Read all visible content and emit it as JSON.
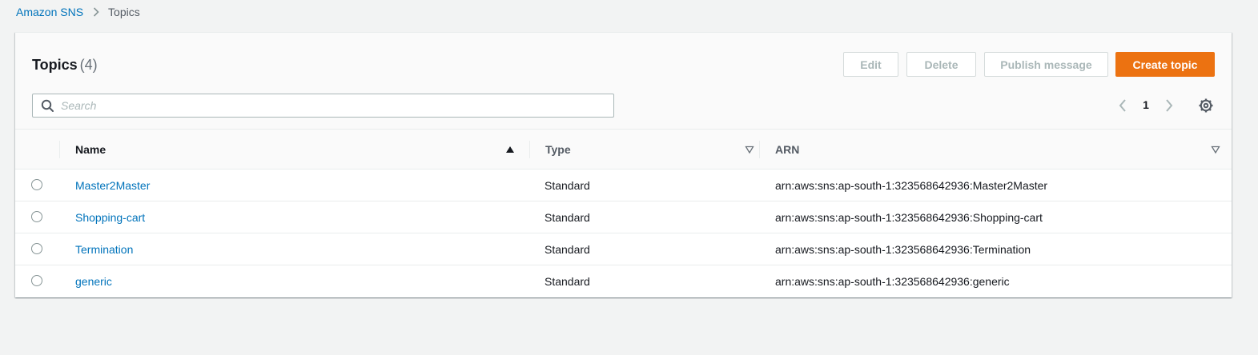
{
  "breadcrumb": {
    "service": "Amazon SNS",
    "current": "Topics"
  },
  "panel": {
    "title": "Topics",
    "count": "(4)"
  },
  "actions": {
    "edit": "Edit",
    "delete": "Delete",
    "publish": "Publish message",
    "create": "Create topic"
  },
  "search": {
    "placeholder": "Search",
    "value": ""
  },
  "pagination": {
    "page": "1"
  },
  "table": {
    "columns": {
      "name": "Name",
      "type": "Type",
      "arn": "ARN"
    },
    "rows": [
      {
        "name": "Master2Master",
        "type": "Standard",
        "arn": "arn:aws:sns:ap-south-1:323568642936:Master2Master"
      },
      {
        "name": "Shopping-cart",
        "type": "Standard",
        "arn": "arn:aws:sns:ap-south-1:323568642936:Shopping-cart"
      },
      {
        "name": "Termination",
        "type": "Standard",
        "arn": "arn:aws:sns:ap-south-1:323568642936:Termination"
      },
      {
        "name": "generic",
        "type": "Standard",
        "arn": "arn:aws:sns:ap-south-1:323568642936:generic"
      }
    ]
  },
  "colors": {
    "link": "#0073bb",
    "primary": "#ec7211",
    "disabled_text": "#aab7b8",
    "background": "#f2f3f3"
  },
  "icons": {
    "breadcrumb_separator": "chevron-right-icon",
    "search": "search-icon",
    "prev": "chevron-left-icon",
    "next": "chevron-right-icon",
    "settings": "gear-icon",
    "sort_ascending": "caret-up-filled-icon",
    "sortable": "caret-down-outline-icon"
  }
}
